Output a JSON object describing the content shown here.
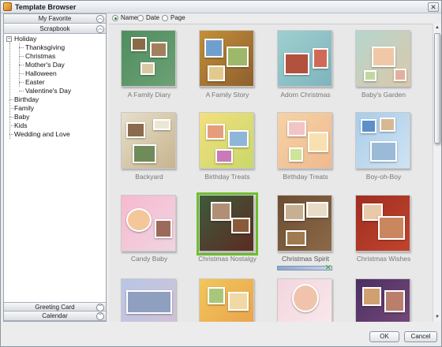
{
  "window": {
    "title": "Template Browser",
    "close_glyph": "✕"
  },
  "left_panel": {
    "header_top": "My Favorite",
    "header_active": "Scrapbook",
    "header_bottom_1": "Greeting Card",
    "header_bottom_2": "Calendar",
    "tree": {
      "holiday": "Holiday",
      "children": [
        "Thanksgiving",
        "Christmas",
        "Mother's Day",
        "Halloween",
        "Easter",
        "Valentine's Day"
      ],
      "others": [
        "Birthday",
        "Family",
        "Baby",
        "Kids",
        "Wedding and Love"
      ]
    }
  },
  "sort": {
    "name": "Name",
    "date": "Date",
    "page": "Page",
    "selected": "Name"
  },
  "templates": [
    {
      "label": "A Family Diary"
    },
    {
      "label": "A Family Story"
    },
    {
      "label": "Adorn Christmas"
    },
    {
      "label": "Baby's Garden"
    },
    {
      "label": "Backyard"
    },
    {
      "label": "Birthday Treats"
    },
    {
      "label": "Birthday Treats"
    },
    {
      "label": "Boy-oh-Boy"
    },
    {
      "label": "Candy Baby"
    },
    {
      "label": "Christmas Nostalgy"
    },
    {
      "label": "Christmas Spirit"
    },
    {
      "label": "Christmas Wishes"
    },
    {
      "label": ""
    },
    {
      "label": ""
    },
    {
      "label": ""
    },
    {
      "label": ""
    }
  ],
  "buttons": {
    "ok": "OK",
    "cancel": "Cancel"
  },
  "colors": {
    "selection": "#6fbf2f",
    "label_gray": "#777777"
  }
}
